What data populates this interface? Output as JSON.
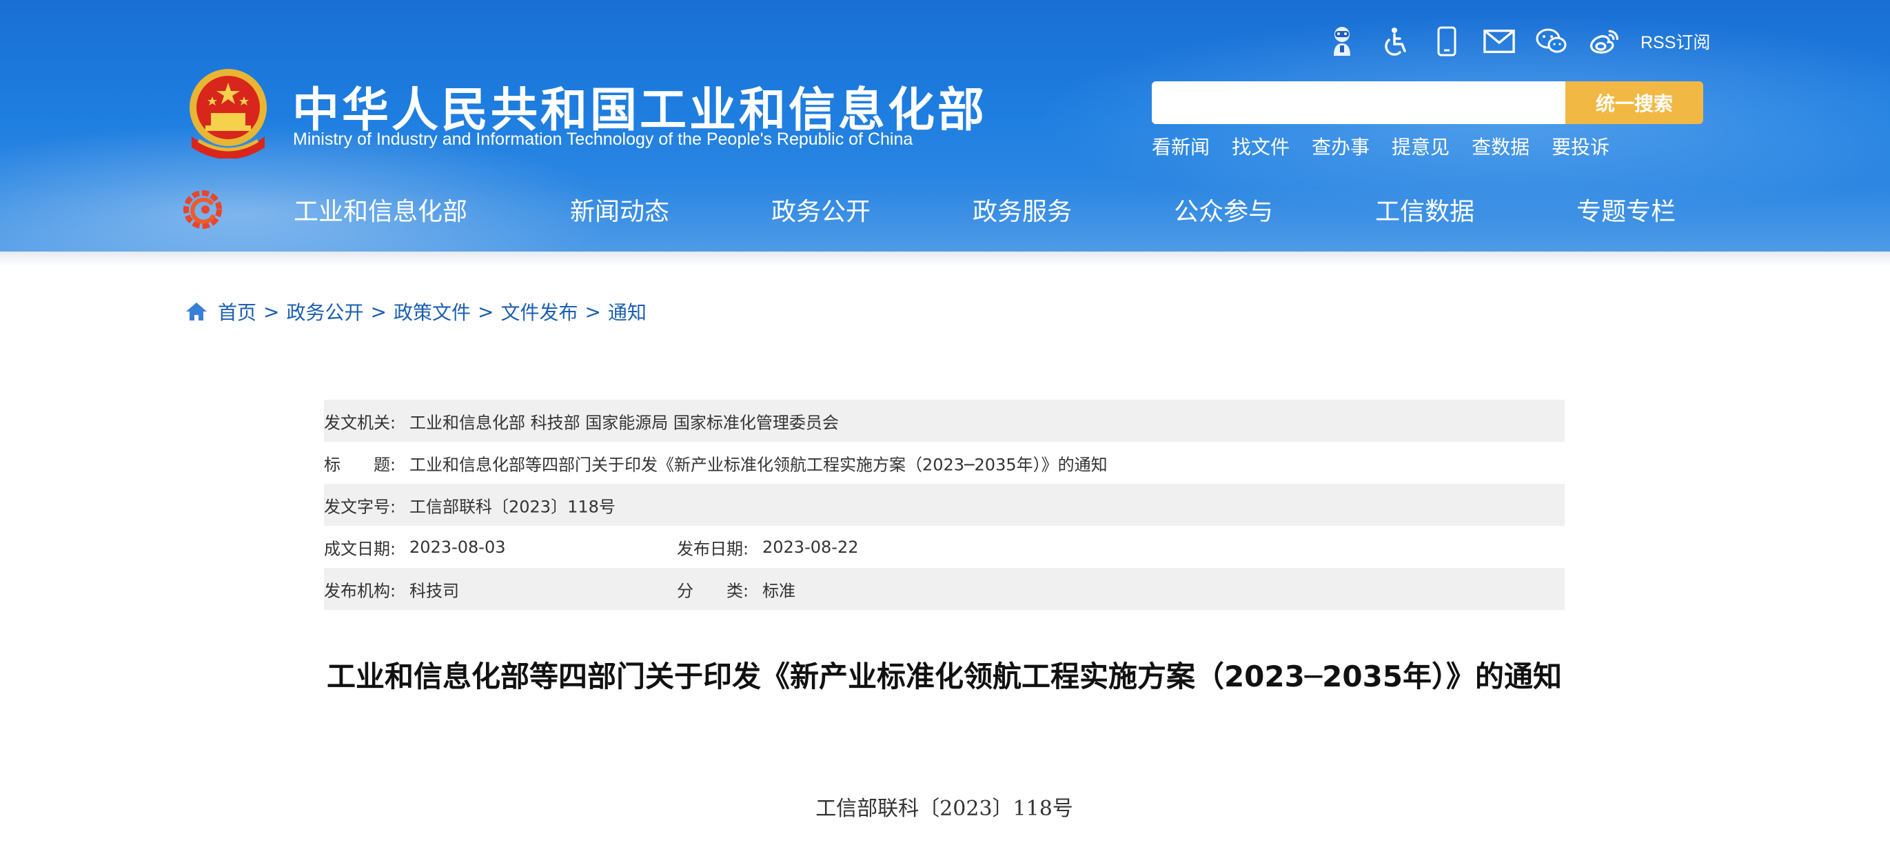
{
  "header": {
    "title": "中华人民共和国工业和信息化部",
    "subtitle": "Ministry of Industry and Information Technology of the People's Republic of China",
    "rss_label": "RSS订阅",
    "search_placeholder": "",
    "search_button": "统一搜索",
    "quick_links": [
      "看新闻",
      "找文件",
      "查办事",
      "提意见",
      "查数据",
      "要投诉"
    ],
    "nav": [
      "工业和信息化部",
      "新闻动态",
      "政务公开",
      "政务服务",
      "公众参与",
      "工信数据",
      "专题专栏"
    ],
    "icons": [
      "assistant-icon",
      "accessibility-icon",
      "mobile-icon",
      "mail-icon",
      "wechat-icon",
      "weibo-icon"
    ]
  },
  "breadcrumb": [
    "首页",
    "政务公开",
    "政策文件",
    "文件发布",
    "通知"
  ],
  "breadcrumb_separator": ">",
  "info": {
    "issuer_label": "发文机关:",
    "issuer_value": "工业和信息化部 科技部 国家能源局 国家标准化管理委员会",
    "title_label": "标　　题:",
    "title_value": "工业和信息化部等四部门关于印发《新产业标准化领航工程实施方案（2023─2035年）》的通知",
    "docno_label": "发文字号:",
    "docno_value": "工信部联科〔2023〕118号",
    "created_label": "成文日期:",
    "created_value": "2023-08-03",
    "published_label": "发布日期:",
    "published_value": "2023-08-22",
    "org_label": "发布机构:",
    "org_value": "科技司",
    "category_label": "分　　类:",
    "category_value": "标准"
  },
  "document": {
    "title": "工业和信息化部等四部门关于印发《新产业标准化领航工程实施方案（2023─2035年）》的通知",
    "number": "工信部联科〔2023〕118号"
  },
  "colors": {
    "header_blue": "#1e7ee0",
    "search_button": "#f2b844",
    "link_blue": "#1b5fb0",
    "row_gray": "#f0f0f0"
  }
}
